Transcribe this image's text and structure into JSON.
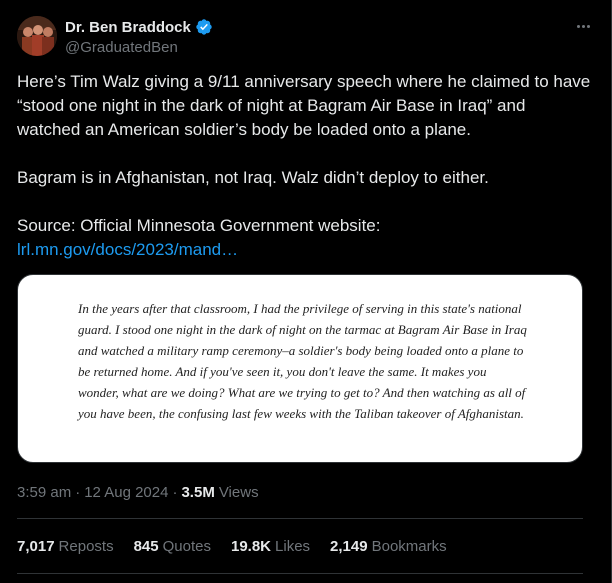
{
  "author": {
    "display_name": "Dr. Ben Braddock",
    "handle": "@GraduatedBen",
    "verified": true,
    "avatar_icon": "profile-photo"
  },
  "tweet": {
    "paragraph1": "Here’s Tim Walz giving a 9/11 anniversary speech where he claimed to have “stood one night in the dark of night at Bagram Air Base in Iraq” and watched an American soldier’s body be loaded onto a plane.",
    "paragraph2": "Bagram is in Afghanistan, not Iraq. Walz didn’t deploy to either.",
    "source_prefix": "Source: Official Minnesota Government website: ",
    "source_link": "lrl.mn.gov/docs/2023/mand…"
  },
  "quote_image": {
    "text": "In the years after that classroom, I had the privilege of serving in this state's national guard. I stood one night in the dark of night on the tarmac at Bagram Air Base in Iraq and watched a military ramp ceremony–a soldier's body being loaded onto a plane to be returned home. And if you've seen it, you don't leave the same. It makes you wonder, what are we doing? What are we trying to get to? And then watching as all of you have been, the confusing last few weeks with the Taliban takeover of Afghanistan."
  },
  "meta": {
    "time": "3:59 am",
    "separator": "·",
    "date": "12 Aug 2024",
    "views_count": "3.5M",
    "views_label": "Views"
  },
  "stats": {
    "reposts_count": "7,017",
    "reposts_label": "Reposts",
    "quotes_count": "845",
    "quotes_label": "Quotes",
    "likes_count": "19.8K",
    "likes_label": "Likes",
    "bookmarks_count": "2,149",
    "bookmarks_label": "Bookmarks"
  },
  "colors": {
    "background": "#000000",
    "text": "#e7e9ea",
    "muted": "#71767b",
    "link": "#1d9bf0",
    "border": "#2f3336"
  }
}
